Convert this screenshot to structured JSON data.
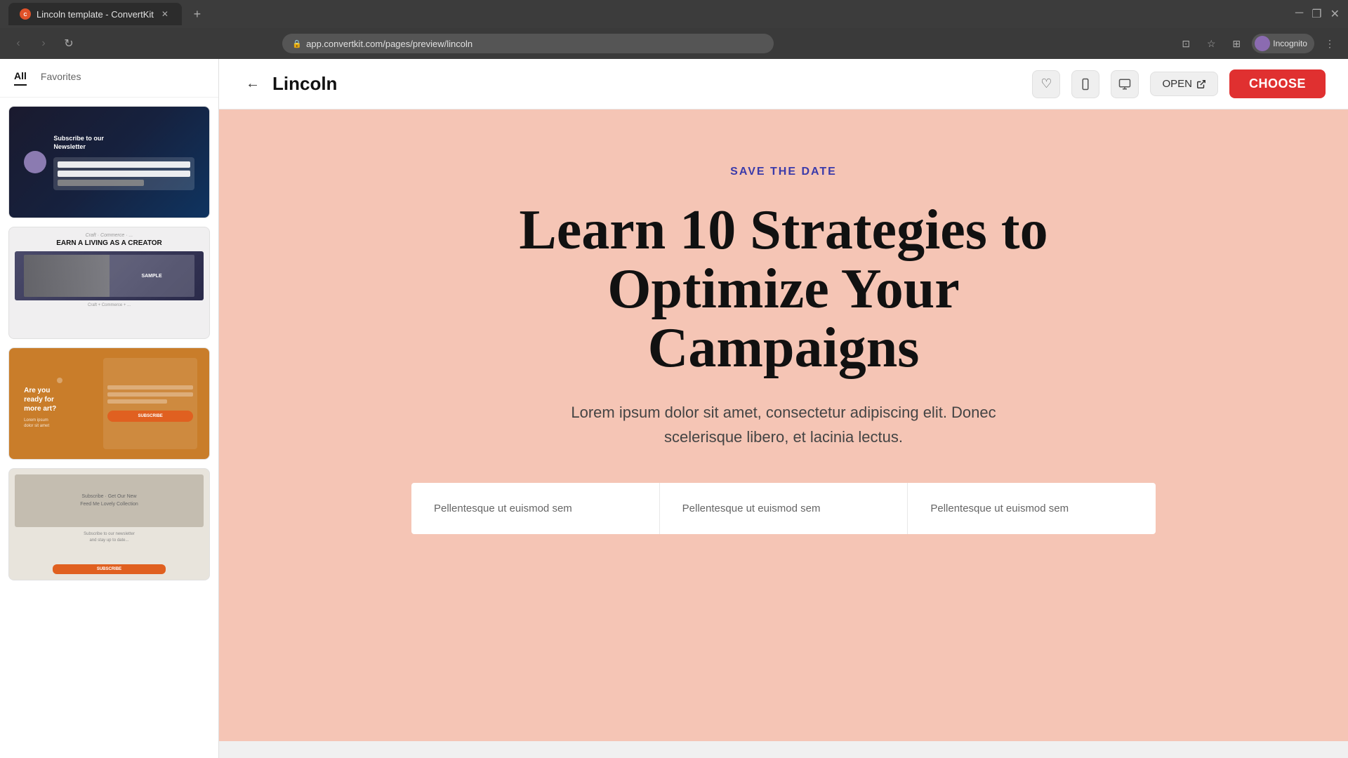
{
  "browser": {
    "tab": {
      "title": "Lincoln template - ConvertKit",
      "favicon_text": "C",
      "url": "app.convertkit.com/pages/preview/lincoln"
    },
    "profile": {
      "label": "Incognito"
    }
  },
  "sidebar": {
    "tabs": [
      {
        "label": "All",
        "active": true
      },
      {
        "label": "Favorites",
        "active": false
      }
    ],
    "templates": [
      {
        "id": "1",
        "name": "Subscribe Newsletter"
      },
      {
        "id": "2",
        "name": "Earn a Living as a Creator"
      },
      {
        "id": "3",
        "name": "Are you ready for more art?"
      },
      {
        "id": "4",
        "name": "Subscribe to Our Newsletter 2"
      }
    ]
  },
  "header": {
    "back_label": "←",
    "title": "Lincoln",
    "heart_icon": "♡",
    "mobile_icon": "📱",
    "desktop_icon": "🖥",
    "open_label": "OPEN",
    "open_icon": "↗",
    "choose_label": "CHOOSE"
  },
  "preview": {
    "save_date_label": "SAVE THE DATE",
    "main_title": "Learn 10 Strategies to Optimize Your Campaigns",
    "subtitle": "Lorem ipsum dolor sit amet, consectetur adipiscing elit. Donec scelerisque libero, et lacinia lectus.",
    "cards": [
      {
        "text": "Pellentesque ut euismod sem"
      },
      {
        "text": "Pellentesque ut euismod sem"
      },
      {
        "text": "Pellentesque ut euismod sem"
      }
    ]
  },
  "colors": {
    "choose_btn_bg": "#e03030",
    "preview_bg": "#f5c5b5",
    "save_date_color": "#3a3aaa"
  }
}
